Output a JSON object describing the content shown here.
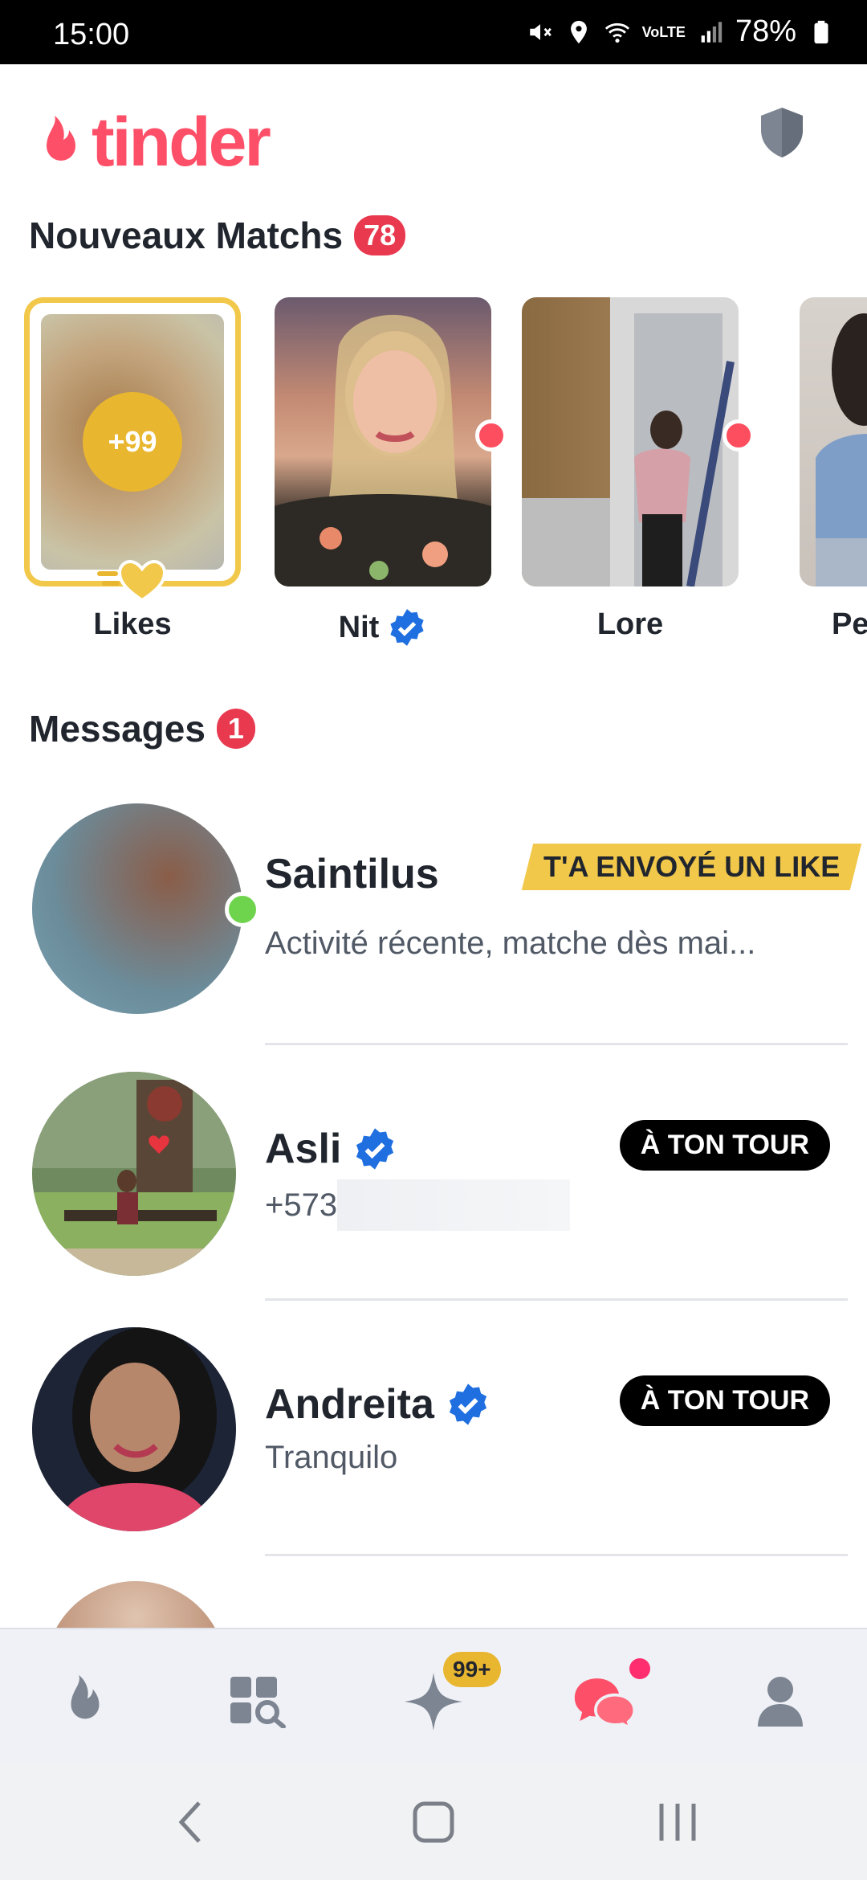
{
  "status_bar": {
    "time": "15:00",
    "battery": "78%",
    "network": "VoLTE"
  },
  "header": {
    "logo_text": "tinder",
    "shield_icon": "shield-icon"
  },
  "new_matches": {
    "title": "Nouveaux Matchs",
    "count": "78",
    "likes": {
      "label": "Likes",
      "count": "+99"
    },
    "items": [
      {
        "name": "Nit",
        "verified": true
      },
      {
        "name": "Lore",
        "verified": false
      },
      {
        "name": "Pe",
        "verified": false
      }
    ]
  },
  "messages": {
    "title": "Messages",
    "count": "1",
    "items": [
      {
        "name": "Saintilus",
        "tag": "T'A ENVOYÉ UN LIKE",
        "preview": "Activité récente, matche dès mai..."
      },
      {
        "name": "Asli",
        "verified": true,
        "tag": "À TON TOUR",
        "preview": "+573"
      },
      {
        "name": "Andreita",
        "verified": true,
        "tag": "À TON TOUR",
        "preview": "Tranquilo"
      }
    ]
  },
  "bottom_nav": {
    "items": [
      "flame-icon",
      "explore-icon",
      "sparkle-icon",
      "chat-icon",
      "profile-icon"
    ],
    "sparkle_badge": "99+"
  },
  "colors": {
    "brand": "#fd5068",
    "gold": "#f2c84b",
    "verified": "#1f6fe0"
  }
}
